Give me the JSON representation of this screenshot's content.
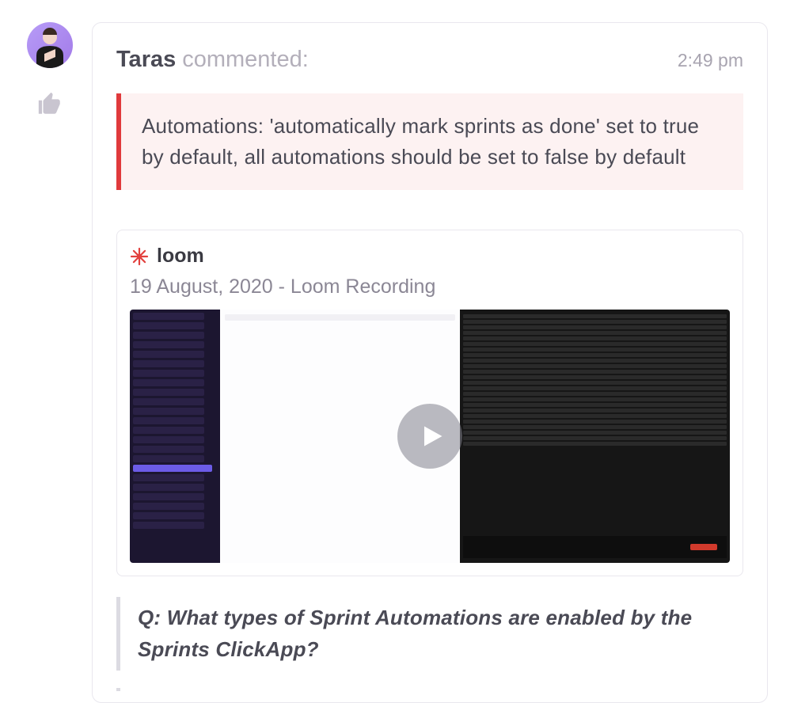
{
  "author": {
    "name": "Taras",
    "action": "commented:"
  },
  "time": "2:49 pm",
  "callout": "Automations: 'automatically mark sprints as done' set to true by default, all automations should be set to false by default",
  "embed": {
    "provider": "loom",
    "title": "19 August, 2020 - Loom Recording"
  },
  "qa": {
    "question": "Q: What types of Sprint Automations are enabled by the Sprints ClickApp?"
  },
  "icons": {
    "thumb": "thumbs-up-icon",
    "play": "play-icon",
    "loom": "loom-logo"
  }
}
